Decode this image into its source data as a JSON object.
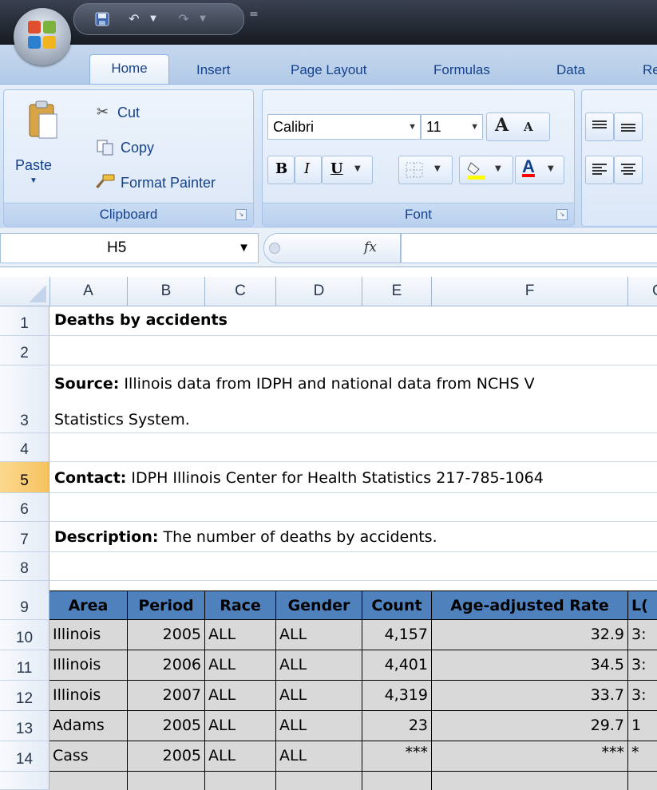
{
  "qat": {
    "customize": "="
  },
  "tabs": [
    "Home",
    "Insert",
    "Page Layout",
    "Formulas",
    "Data",
    "Re"
  ],
  "clipboard": {
    "paste": "Paste",
    "cut": "Cut",
    "copy": "Copy",
    "format_painter": "Format Painter",
    "label": "Clipboard"
  },
  "font": {
    "name": "Calibri",
    "size": "11",
    "bold": "B",
    "italic": "I",
    "underline": "U",
    "font_color": "A",
    "grow": "A",
    "shrink": "A",
    "label": "Font"
  },
  "formula_bar": {
    "name_box": "H5",
    "fx": "fx",
    "value": ""
  },
  "columns": [
    "A",
    "B",
    "C",
    "D",
    "E",
    "F",
    "G"
  ],
  "rows": [
    "1",
    "2",
    "3",
    "4",
    "5",
    "6",
    "7",
    "8",
    "9",
    "10",
    "11",
    "12",
    "13",
    "14"
  ],
  "active_row": "5",
  "sheet": {
    "title": "Deaths by accidents",
    "source_label": "Source:",
    "source_text": " Illinois data from IDPH and national data from NCHS V",
    "source_text2": "Statistics System.",
    "contact_label": "Contact:",
    "contact_text": " IDPH Illinois Center for Health Statistics 217-785-1064",
    "description_label": "Description:",
    "description_text": " The number of deaths by accidents."
  },
  "table": {
    "headers": [
      "Area",
      "Period",
      "Race",
      "Gender",
      "Count",
      "Age-adjusted Rate",
      "L("
    ],
    "rows": [
      [
        "Illinois",
        "2005",
        "ALL",
        "ALL",
        "4,157",
        "32.9",
        "3:"
      ],
      [
        "Illinois",
        "2006",
        "ALL",
        "ALL",
        "4,401",
        "34.5",
        "3:"
      ],
      [
        "Illinois",
        "2007",
        "ALL",
        "ALL",
        "4,319",
        "33.7",
        "3:"
      ],
      [
        "Adams",
        "2005",
        "ALL",
        "ALL",
        "23",
        "29.7",
        "1"
      ],
      [
        "Cass",
        "2005",
        "ALL",
        "ALL",
        "***",
        "***",
        "*"
      ]
    ]
  },
  "colors": {
    "header_fill": "#4f81bd",
    "row_fill": "#d9d9d9",
    "active_row": "#f6c25f"
  }
}
